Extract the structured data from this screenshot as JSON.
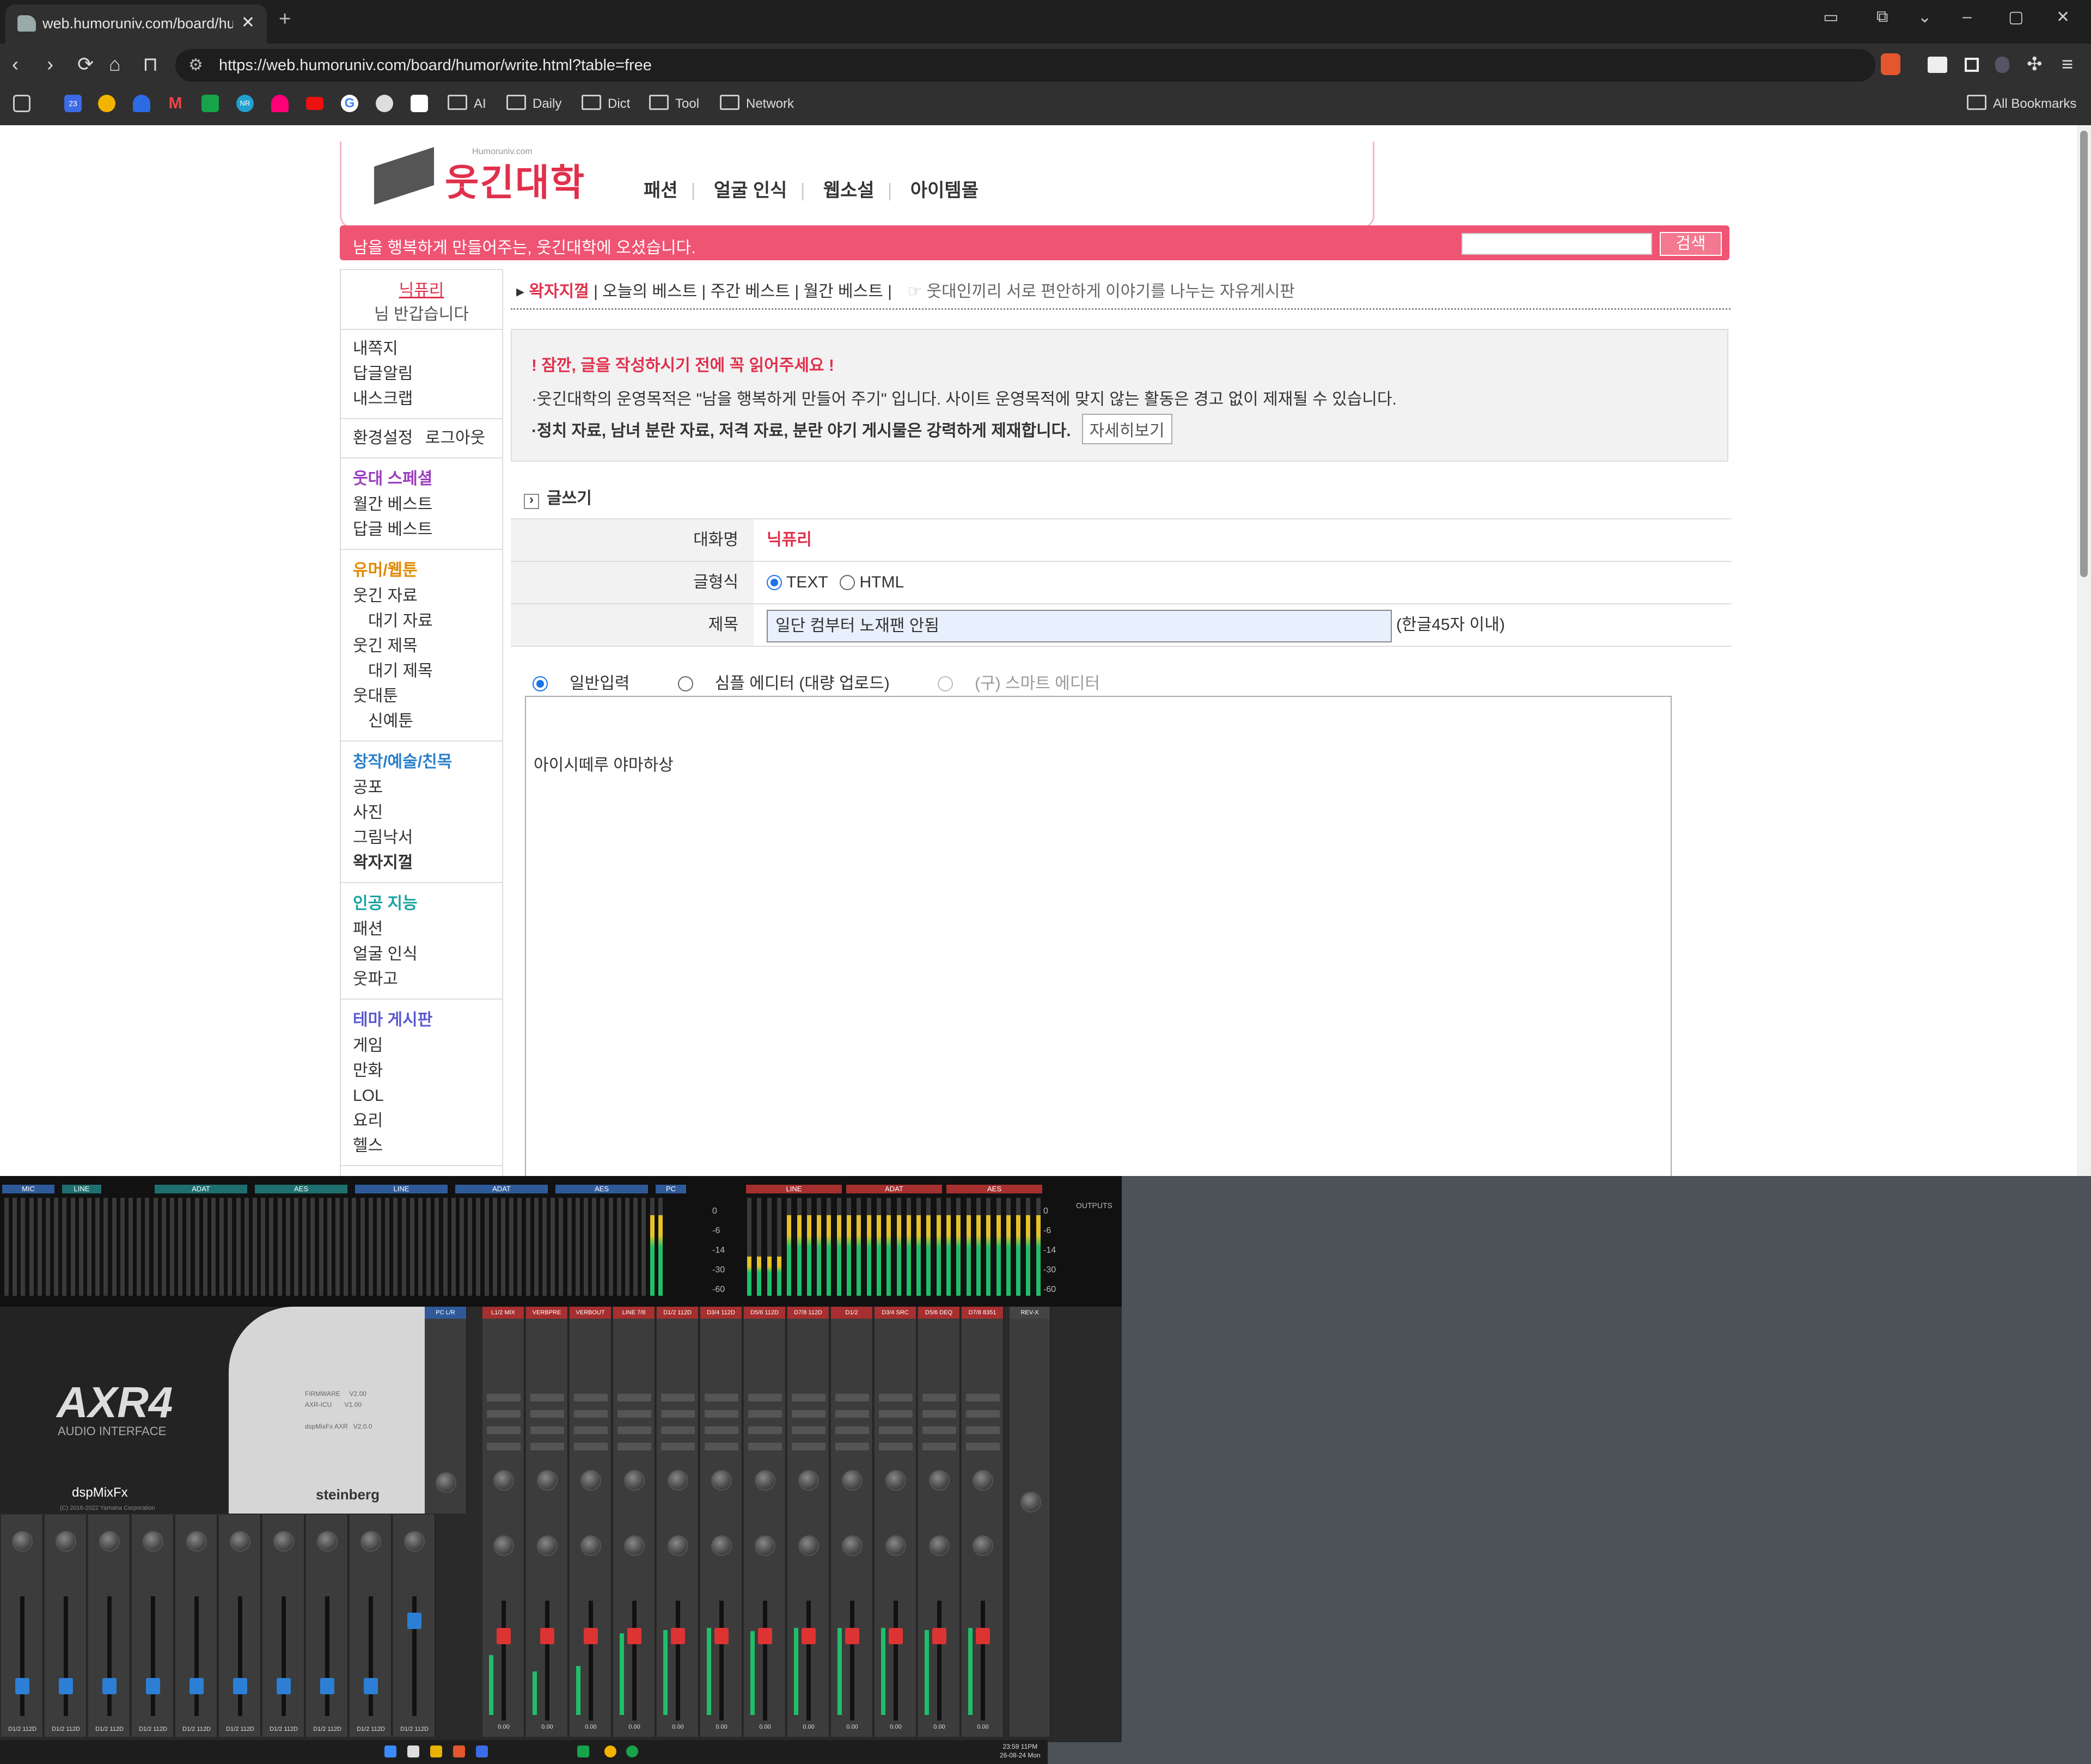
{
  "browser": {
    "tab_title": "web.humoruniv.com/board/hum",
    "tab_close": "✕",
    "new_tab": "+",
    "window_controls": [
      "▭",
      "⧉",
      "⌄",
      "–",
      "▢",
      "✕"
    ],
    "url": "https://web.humoruniv.com/board/humor/write.html?table=free",
    "nav_icons": [
      "‹",
      "›",
      "⟳",
      "⌂",
      "⊓"
    ],
    "bookmarks_left_icons": [
      "23",
      "",
      "",
      "M",
      "",
      "NR",
      "",
      "",
      "G",
      "",
      ""
    ],
    "bookmark_folders": [
      "AI",
      "Daily",
      "Dict",
      "Tool",
      "Network"
    ],
    "all_bookmarks": "All Bookmarks"
  },
  "site": {
    "logo_text": "웃긴대학",
    "logo_sub": "Humoruniv.com",
    "top_menu": [
      "패션",
      "얼굴 인식",
      "웹소설",
      "아이템몰"
    ],
    "welcome": "남을 행복하게 만들어주는, 웃긴대학에 오셨습니다.",
    "search_button": "검색",
    "sidebar": {
      "user_nick": "닉퓨리",
      "greeting": "님 반갑습니다",
      "user_links": [
        "내쪽지",
        "답글알림",
        "내스크랩"
      ],
      "settings": "환경설정",
      "logout": "로그아웃",
      "groups": [
        {
          "title": "웃대 스페셜",
          "color": "#9b3dbf",
          "items": [
            {
              "label": "월간 베스트",
              "sub": false,
              "bold": false
            },
            {
              "label": "답글 베스트",
              "sub": false,
              "bold": false
            }
          ]
        },
        {
          "title": "유머/웹툰",
          "color": "#e08a00",
          "items": [
            {
              "label": "웃긴 자료",
              "sub": false,
              "bold": false
            },
            {
              "label": "대기 자료",
              "sub": true,
              "bold": false
            },
            {
              "label": "웃긴 제목",
              "sub": false,
              "bold": false
            },
            {
              "label": "대기 제목",
              "sub": true,
              "bold": false
            },
            {
              "label": "웃대툰",
              "sub": false,
              "bold": false
            },
            {
              "label": "신예툰",
              "sub": true,
              "bold": false
            }
          ]
        },
        {
          "title": "창작/예술/친목",
          "color": "#2a7fc9",
          "items": [
            {
              "label": "공포",
              "sub": false,
              "bold": false
            },
            {
              "label": "사진",
              "sub": false,
              "bold": false
            },
            {
              "label": "그림낙서",
              "sub": false,
              "bold": false
            },
            {
              "label": "왁자지껄",
              "sub": false,
              "bold": true
            }
          ]
        },
        {
          "title": "인공 지능",
          "color": "#1aa3a3",
          "items": [
            {
              "label": "패션",
              "sub": false,
              "bold": false
            },
            {
              "label": "얼굴 인식",
              "sub": false,
              "bold": false
            },
            {
              "label": "웃파고",
              "sub": false,
              "bold": false
            }
          ]
        },
        {
          "title": "테마 게시판",
          "color": "#5a5acf",
          "items": [
            {
              "label": "게임",
              "sub": false,
              "bold": false
            },
            {
              "label": "만화",
              "sub": false,
              "bold": false
            },
            {
              "label": "LOL",
              "sub": false,
              "bold": false
            },
            {
              "label": "요리",
              "sub": false,
              "bold": false
            },
            {
              "label": "헬스",
              "sub": false,
              "bold": false
            }
          ]
        }
      ]
    },
    "breadcrumb": {
      "active": "왁자지껄",
      "links": [
        "오늘의 베스트",
        "주간 베스트",
        "월간 베스트"
      ],
      "desc": "웃대인끼리 서로 편안하게 이야기를 나누는 자유게시판"
    },
    "notice": {
      "heading": "! 잠깐, 글을 작성하시기 전에 꼭 읽어주세요 !",
      "line1": "·웃긴대학의 운영목적은 \"남을 행복하게 만들어 주기\" 입니다. 사이트 운영목적에 맞지 않는 활동은 경고 없이 제재될 수 있습니다.",
      "line2": "·정치 자료, 남녀 분란 자료, 저격 자료, 분란 야기 게시물은 강력하게 제재합니다.",
      "more_button": "자세히보기"
    },
    "write": {
      "section_title": "글쓰기",
      "nick_label": "대화명",
      "nick_value": "닉퓨리",
      "format_label": "글형식",
      "format_options": [
        "TEXT",
        "HTML"
      ],
      "format_selected": "TEXT",
      "title_label": "제목",
      "title_value": "일단 컴부터 노재팬 안됨",
      "title_hint": "(한글45자 이내)",
      "editor_modes": [
        "일반입력",
        "심플 에디터 (대량 업로드)",
        "(구) 스마트 에디터"
      ],
      "editor_mode_selected": "일반입력",
      "body_text": "아이시떼루 야마하상"
    }
  },
  "mixer": {
    "input_tags": [
      "MIC",
      "LINE",
      "ADAT",
      "AES",
      "LINE",
      "ADAT",
      "AES",
      "PC"
    ],
    "output_tags": [
      "LINE",
      "ADAT",
      "AES"
    ],
    "outputs_label": "OUTPUTS",
    "scale": [
      "0",
      "-6",
      "-14",
      "-30",
      "-60"
    ],
    "device": "AXR4",
    "device_sub": "AUDIO INTERFACE",
    "app_name": "dspMixFx",
    "copyright": "(C) 2016-2022 Yamaha Corporation",
    "firmware_info": "FIRMWARE     V2.00\nAXR-ICU       V1.00\n\ndspMixFx AXR   V2.0.0",
    "brand": "steinberg",
    "pc_strip": "PC L/R",
    "bus_strips": [
      "L1/2 MIX",
      "VERBPRE",
      "VERBOUT",
      "LINE 7/8",
      "D1/2 112D",
      "D3/4 112D",
      "D5/6 112D",
      "D7/8 112D",
      "D1/2",
      "D3/4 SRC",
      "D5/6 DEQ",
      "D7/8 8351"
    ],
    "bus_levels": [
      0.55,
      0.4,
      0.45,
      0.75,
      0.78,
      0.8,
      0.77,
      0.8,
      0.8,
      0.8,
      0.78,
      0.8
    ],
    "input_strip_label": "D1/2 112D",
    "reverb_label": "REV-X",
    "value_label": "0.00"
  },
  "taskbar": {
    "clock_time": "23:59 11PM",
    "clock_date": "26-08-24 Mon"
  }
}
